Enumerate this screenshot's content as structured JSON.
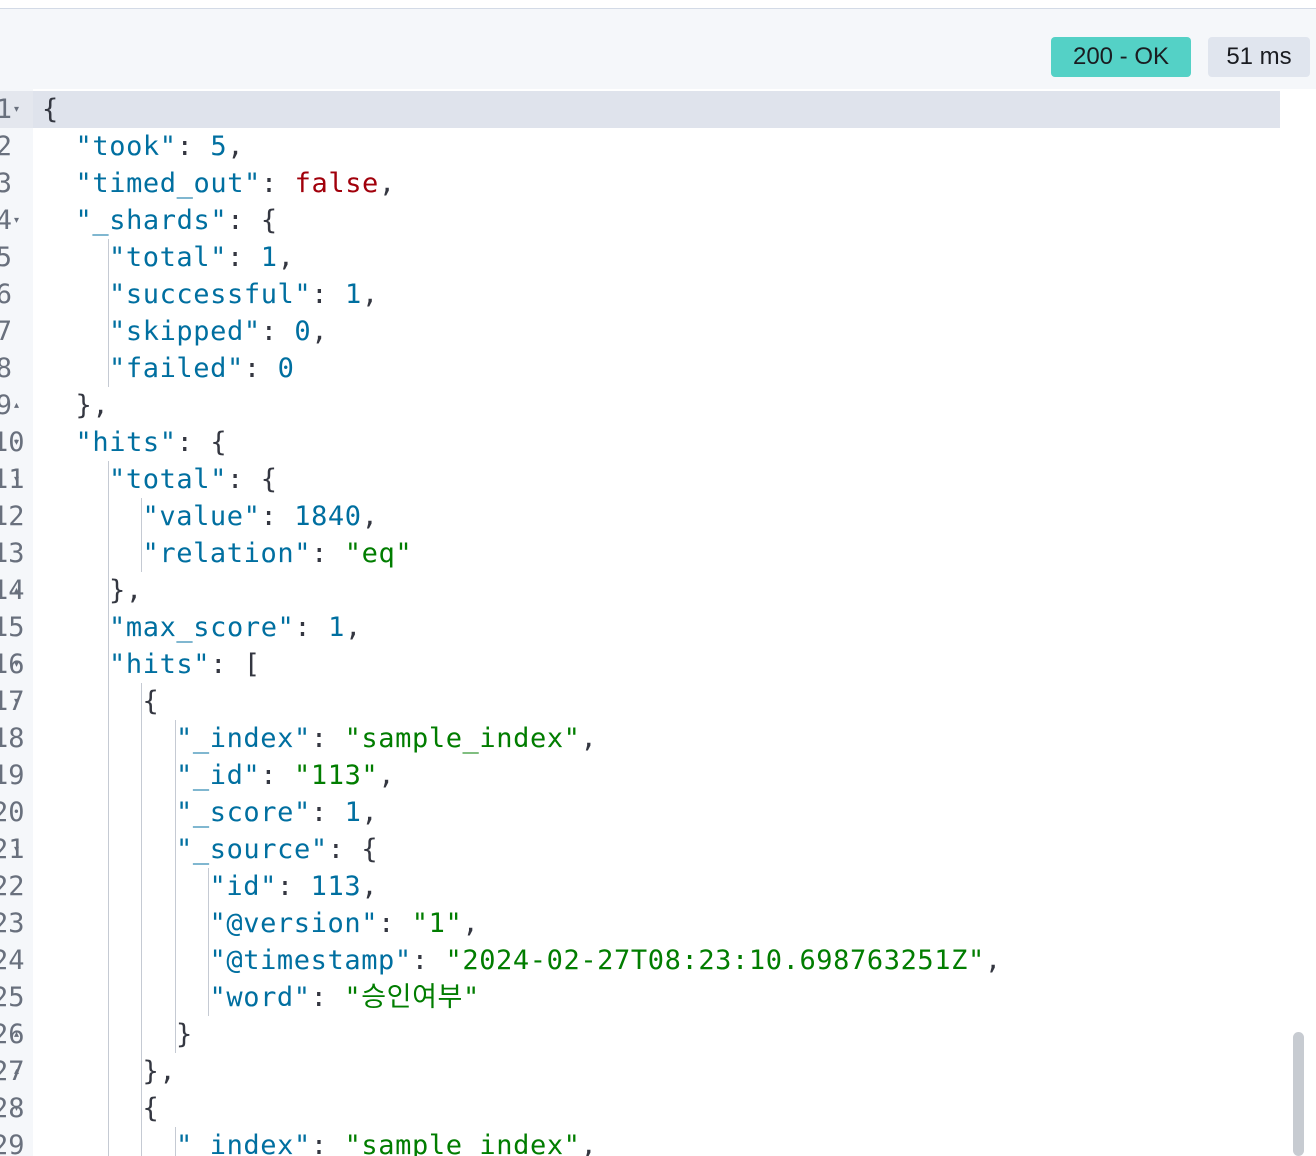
{
  "response": {
    "status": "200 - OK",
    "time": "51 ms"
  },
  "editor": {
    "lines": [
      {
        "num": "1",
        "fold": "▾",
        "indent": 0,
        "tokens": [
          {
            "t": "{",
            "c": "p"
          }
        ]
      },
      {
        "num": "2",
        "fold": "",
        "indent": 1,
        "tokens": [
          {
            "t": "\"took\"",
            "c": "k"
          },
          {
            "t": ": ",
            "c": "p"
          },
          {
            "t": "5",
            "c": "n"
          },
          {
            "t": ",",
            "c": "p"
          }
        ]
      },
      {
        "num": "3",
        "fold": "",
        "indent": 1,
        "tokens": [
          {
            "t": "\"timed_out\"",
            "c": "k"
          },
          {
            "t": ": ",
            "c": "p"
          },
          {
            "t": "false",
            "c": "b"
          },
          {
            "t": ",",
            "c": "p"
          }
        ]
      },
      {
        "num": "4",
        "fold": "▾",
        "indent": 1,
        "tokens": [
          {
            "t": "\"_shards\"",
            "c": "k"
          },
          {
            "t": ": {",
            "c": "p"
          }
        ]
      },
      {
        "num": "5",
        "fold": "",
        "indent": 2,
        "tokens": [
          {
            "t": "\"total\"",
            "c": "k"
          },
          {
            "t": ": ",
            "c": "p"
          },
          {
            "t": "1",
            "c": "n"
          },
          {
            "t": ",",
            "c": "p"
          }
        ]
      },
      {
        "num": "6",
        "fold": "",
        "indent": 2,
        "tokens": [
          {
            "t": "\"successful\"",
            "c": "k"
          },
          {
            "t": ": ",
            "c": "p"
          },
          {
            "t": "1",
            "c": "n"
          },
          {
            "t": ",",
            "c": "p"
          }
        ]
      },
      {
        "num": "7",
        "fold": "",
        "indent": 2,
        "tokens": [
          {
            "t": "\"skipped\"",
            "c": "k"
          },
          {
            "t": ": ",
            "c": "p"
          },
          {
            "t": "0",
            "c": "n"
          },
          {
            "t": ",",
            "c": "p"
          }
        ]
      },
      {
        "num": "8",
        "fold": "",
        "indent": 2,
        "tokens": [
          {
            "t": "\"failed\"",
            "c": "k"
          },
          {
            "t": ": ",
            "c": "p"
          },
          {
            "t": "0",
            "c": "n"
          }
        ]
      },
      {
        "num": "9",
        "fold": "▴",
        "indent": 1,
        "tokens": [
          {
            "t": "},",
            "c": "p"
          }
        ]
      },
      {
        "num": "10",
        "fold": "▾",
        "indent": 1,
        "tokens": [
          {
            "t": "\"hits\"",
            "c": "k"
          },
          {
            "t": ": {",
            "c": "p"
          }
        ]
      },
      {
        "num": "11",
        "fold": "▾",
        "indent": 2,
        "tokens": [
          {
            "t": "\"total\"",
            "c": "k"
          },
          {
            "t": ": {",
            "c": "p"
          }
        ]
      },
      {
        "num": "12",
        "fold": "",
        "indent": 3,
        "tokens": [
          {
            "t": "\"value\"",
            "c": "k"
          },
          {
            "t": ": ",
            "c": "p"
          },
          {
            "t": "1840",
            "c": "n"
          },
          {
            "t": ",",
            "c": "p"
          }
        ]
      },
      {
        "num": "13",
        "fold": "",
        "indent": 3,
        "tokens": [
          {
            "t": "\"relation\"",
            "c": "k"
          },
          {
            "t": ": ",
            "c": "p"
          },
          {
            "t": "\"eq\"",
            "c": "s"
          }
        ]
      },
      {
        "num": "14",
        "fold": "▴",
        "indent": 2,
        "tokens": [
          {
            "t": "},",
            "c": "p"
          }
        ]
      },
      {
        "num": "15",
        "fold": "",
        "indent": 2,
        "tokens": [
          {
            "t": "\"max_score\"",
            "c": "k"
          },
          {
            "t": ": ",
            "c": "p"
          },
          {
            "t": "1",
            "c": "n"
          },
          {
            "t": ",",
            "c": "p"
          }
        ]
      },
      {
        "num": "16",
        "fold": "▾",
        "indent": 2,
        "tokens": [
          {
            "t": "\"hits\"",
            "c": "k"
          },
          {
            "t": ": [",
            "c": "p"
          }
        ]
      },
      {
        "num": "17",
        "fold": "▾",
        "indent": 3,
        "tokens": [
          {
            "t": "{",
            "c": "p"
          }
        ]
      },
      {
        "num": "18",
        "fold": "",
        "indent": 4,
        "tokens": [
          {
            "t": "\"_index\"",
            "c": "k"
          },
          {
            "t": ": ",
            "c": "p"
          },
          {
            "t": "\"sample_index\"",
            "c": "s"
          },
          {
            "t": ",",
            "c": "p"
          }
        ]
      },
      {
        "num": "19",
        "fold": "",
        "indent": 4,
        "tokens": [
          {
            "t": "\"_id\"",
            "c": "k"
          },
          {
            "t": ": ",
            "c": "p"
          },
          {
            "t": "\"113\"",
            "c": "s"
          },
          {
            "t": ",",
            "c": "p"
          }
        ]
      },
      {
        "num": "20",
        "fold": "",
        "indent": 4,
        "tokens": [
          {
            "t": "\"_score\"",
            "c": "k"
          },
          {
            "t": ": ",
            "c": "p"
          },
          {
            "t": "1",
            "c": "n"
          },
          {
            "t": ",",
            "c": "p"
          }
        ]
      },
      {
        "num": "21",
        "fold": "▾",
        "indent": 4,
        "tokens": [
          {
            "t": "\"_source\"",
            "c": "k"
          },
          {
            "t": ": {",
            "c": "p"
          }
        ]
      },
      {
        "num": "22",
        "fold": "",
        "indent": 5,
        "tokens": [
          {
            "t": "\"id\"",
            "c": "k"
          },
          {
            "t": ": ",
            "c": "p"
          },
          {
            "t": "113",
            "c": "n"
          },
          {
            "t": ",",
            "c": "p"
          }
        ]
      },
      {
        "num": "23",
        "fold": "",
        "indent": 5,
        "tokens": [
          {
            "t": "\"@version\"",
            "c": "k"
          },
          {
            "t": ": ",
            "c": "p"
          },
          {
            "t": "\"1\"",
            "c": "s"
          },
          {
            "t": ",",
            "c": "p"
          }
        ]
      },
      {
        "num": "24",
        "fold": "",
        "indent": 5,
        "tokens": [
          {
            "t": "\"@timestamp\"",
            "c": "k"
          },
          {
            "t": ": ",
            "c": "p"
          },
          {
            "t": "\"2024-02-27T08:23:10.698763251Z\"",
            "c": "s"
          },
          {
            "t": ",",
            "c": "p"
          }
        ]
      },
      {
        "num": "25",
        "fold": "",
        "indent": 5,
        "tokens": [
          {
            "t": "\"word\"",
            "c": "k"
          },
          {
            "t": ": ",
            "c": "p"
          },
          {
            "t": "\"승인여부\"",
            "c": "s"
          }
        ]
      },
      {
        "num": "26",
        "fold": "▴",
        "indent": 4,
        "tokens": [
          {
            "t": "}",
            "c": "p"
          }
        ]
      },
      {
        "num": "27",
        "fold": "▴",
        "indent": 3,
        "tokens": [
          {
            "t": "},",
            "c": "p"
          }
        ]
      },
      {
        "num": "28",
        "fold": "▾",
        "indent": 3,
        "tokens": [
          {
            "t": "{",
            "c": "p"
          }
        ]
      },
      {
        "num": "29",
        "fold": "",
        "indent": 4,
        "tokens": [
          {
            "t": "\"_index\"",
            "c": "k"
          },
          {
            "t": ": ",
            "c": "p"
          },
          {
            "t": "\"sample_index\"",
            "c": "s"
          },
          {
            "t": ",",
            "c": "p"
          }
        ]
      }
    ]
  }
}
